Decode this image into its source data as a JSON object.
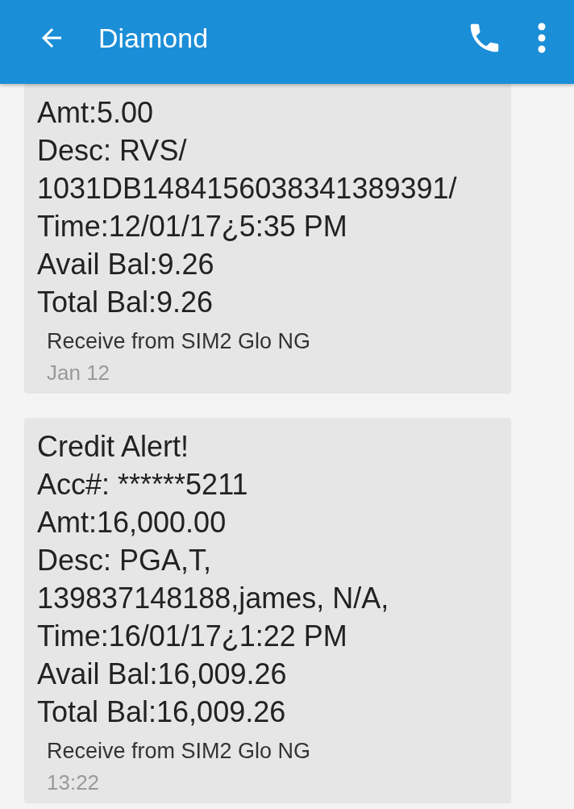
{
  "header": {
    "title": "Diamond"
  },
  "messages": [
    {
      "lines": [
        "Amt:5.00",
        "Desc: RVS/",
        "1031DB1484156038341389391/",
        "Time:12/01/17¿5:35 PM",
        "Avail Bal:9.26",
        "Total Bal:9.26"
      ],
      "sim": "Receive from SIM2 Glo NG",
      "time": "Jan 12"
    },
    {
      "lines": [
        "Credit Alert!",
        "Acc#: ******5211",
        "Amt:16,000.00",
        "Desc: PGA,T,",
        "139837148188,james, N/A,",
        "Time:16/01/17¿1:22 PM",
        "Avail Bal:16,009.26",
        "Total Bal:16,009.26"
      ],
      "sim": "Receive from SIM2 Glo NG",
      "time": "13:22"
    }
  ]
}
